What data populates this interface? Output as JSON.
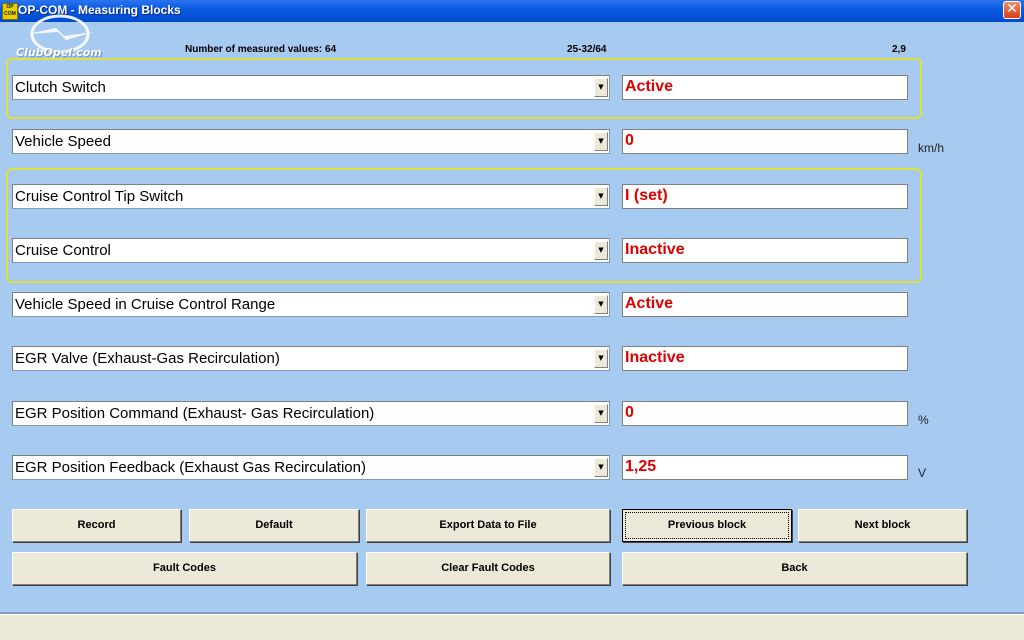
{
  "window": {
    "title": "OP-COM - Measuring Blocks",
    "app_icon_text": "OP COM",
    "close_symbol": "✕"
  },
  "logo": {
    "text": "ClubOpel.com"
  },
  "header": {
    "measured_values_label": "Number of measured values: 64",
    "range_label": "25-32/64",
    "value_label": "2,9"
  },
  "rows": [
    {
      "label": "Clutch Switch",
      "value": "Active",
      "unit": ""
    },
    {
      "label": "Vehicle Speed",
      "value": "0",
      "unit": "km/h"
    },
    {
      "label": "Cruise Control Tip Switch",
      "value": "I (set)",
      "unit": ""
    },
    {
      "label": "Cruise Control",
      "value": "Inactive",
      "unit": ""
    },
    {
      "label": "Vehicle Speed in Cruise Control Range",
      "value": "Active",
      "unit": ""
    },
    {
      "label": "EGR Valve (Exhaust-Gas Recirculation)",
      "value": "Inactive",
      "unit": ""
    },
    {
      "label": "EGR Position Command (Exhaust- Gas Recirculation)",
      "value": "0",
      "unit": "%"
    },
    {
      "label": "EGR Position Feedback (Exhaust Gas Recirculation)",
      "value": "1,25",
      "unit": "V"
    }
  ],
  "buttons": {
    "record": "Record",
    "default": "Default",
    "export": "Export Data to File",
    "previous": "Previous block",
    "next": "Next block",
    "fault_codes": "Fault Codes",
    "clear_fault_codes": "Clear Fault Codes",
    "back": "Back"
  },
  "colors": {
    "background": "#a6caf0",
    "value_text": "#e00000",
    "highlight": "#e0e040",
    "titlebar": "#0a5ae0"
  }
}
